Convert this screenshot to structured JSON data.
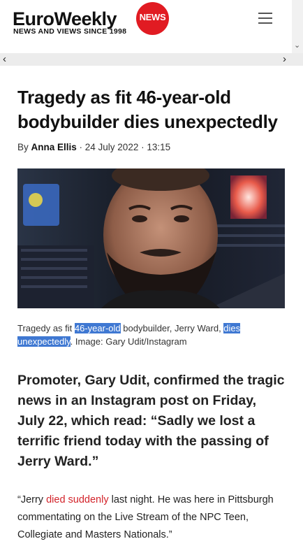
{
  "header": {
    "logo_text": "EuroWeekly",
    "logo_badge": "NEWS",
    "tagline": "NEWS AND VIEWS SINCE 1998"
  },
  "nav": {
    "left_arrow": "‹",
    "right_arrow": "›",
    "strip_arrow": "⌄"
  },
  "article": {
    "title": "Tragedy as fit 46-year-old bodybuilder dies unexpectedly",
    "byline_prefix": "By ",
    "author": "Anna Ellis",
    "byline_suffix": " · 24 July 2022 · 13:15",
    "caption_part1": "Tragedy as fit ",
    "caption_hl1": "46-year-old",
    "caption_part2": " bodybuilder, Jerry Ward, ",
    "caption_hl2": "dies unexpectedly",
    "caption_part3": ". Image: Gary Udit/Instagram",
    "lead": "Promoter, Gary Udit, confirmed the tragic news in an Instagram post on Friday, July 22, which read: “Sadly we lost a terrific friend today with the passing of Jerry Ward.”",
    "body_part1": "“Jerry ",
    "body_link": "died suddenly",
    "body_part2": " last night. He was here in Pittsburgh commentating on the Live Stream of the NPC Teen, Collegiate and Masters Nationals.”"
  },
  "colors": {
    "brand_red": "#e11b22",
    "highlight": "#3f78d2",
    "link_red": "#d3232a"
  }
}
